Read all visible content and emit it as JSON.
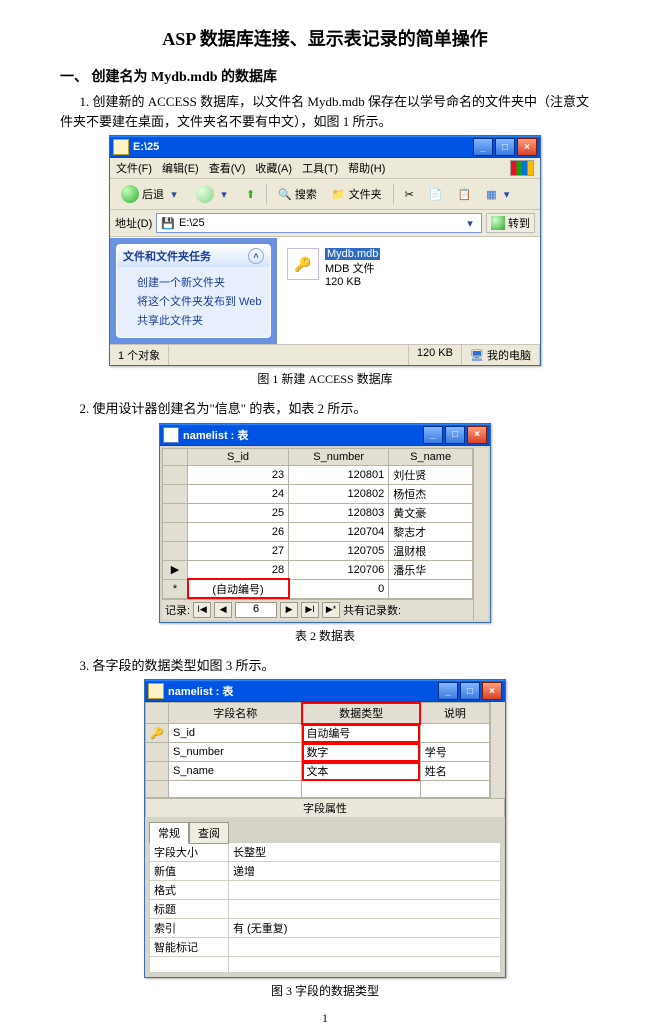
{
  "title": "ASP 数据库连接、显示表记录的简单操作",
  "section1": {
    "heading": "一、  创建名为 Mydb.mdb 的数据库",
    "p1": "1. 创建新的 ACCESS 数据库，以文件名 Mydb.mdb 保存在以学号命名的文件夹中（注意文件夹不要建在桌面，文件夹名不要有中文），如图 1 所示。",
    "caption1": "图 1  新建 ACCESS 数据库",
    "p2": "2. 使用设计器创建名为\"信息\"  的表，如表 2 所示。",
    "caption2": "表 2    数据表",
    "p3": "3. 各字段的数据类型如图 3 所示。",
    "caption3": "图 3  字段的数据类型"
  },
  "explorer": {
    "title": "E:\\25",
    "menu": [
      "文件(F)",
      "编辑(E)",
      "查看(V)",
      "收藏(A)",
      "工具(T)",
      "帮助(H)"
    ],
    "back": "后退",
    "search": "搜索",
    "folders": "文件夹",
    "addr_label": "地址(D)",
    "addr_value": "E:\\25",
    "go": "转到",
    "task_header": "文件和文件夹任务",
    "tasks": [
      "创建一个新文件夹",
      "将这个文件夹发布到 Web",
      "共享此文件夹"
    ],
    "file": {
      "name": "Mydb.mdb",
      "type": "MDB 文件",
      "size": "120 KB"
    },
    "status_objects": "1 个对象",
    "status_size": "120 KB",
    "status_loc": "我的电脑"
  },
  "datasheet": {
    "title": "namelist : 表",
    "cols": [
      "S_id",
      "S_number",
      "S_name"
    ],
    "rows": [
      {
        "id": "23",
        "num": "120801",
        "name": "刘仕贤"
      },
      {
        "id": "24",
        "num": "120802",
        "name": "杨恒杰"
      },
      {
        "id": "25",
        "num": "120803",
        "name": "黄文豪"
      },
      {
        "id": "26",
        "num": "120704",
        "name": "黎志才"
      },
      {
        "id": "27",
        "num": "120705",
        "name": "温财根"
      },
      {
        "id": "28",
        "num": "120706",
        "name": "潘乐华"
      }
    ],
    "newrow_id": "(自动编号)",
    "newrow_num": "0",
    "nav_label_left": "记录:",
    "nav_value": "6",
    "nav_label_right": "共有记录数:"
  },
  "design": {
    "title": "namelist : 表",
    "headers": [
      "字段名称",
      "数据类型",
      "说明"
    ],
    "rows": [
      {
        "name": "S_id",
        "type": "自动编号",
        "desc": ""
      },
      {
        "name": "S_number",
        "type": "数字",
        "desc": "学号"
      },
      {
        "name": "S_name",
        "type": "文本",
        "desc": "姓名"
      }
    ],
    "props_header": "字段属性",
    "tabs": [
      "常规",
      "查阅"
    ],
    "props": [
      {
        "k": "字段大小",
        "v": "长整型"
      },
      {
        "k": "新值",
        "v": "递增"
      },
      {
        "k": "格式",
        "v": ""
      },
      {
        "k": "标题",
        "v": ""
      },
      {
        "k": "索引",
        "v": "有 (无重复)"
      },
      {
        "k": "智能标记",
        "v": ""
      }
    ]
  },
  "page_number": "1"
}
